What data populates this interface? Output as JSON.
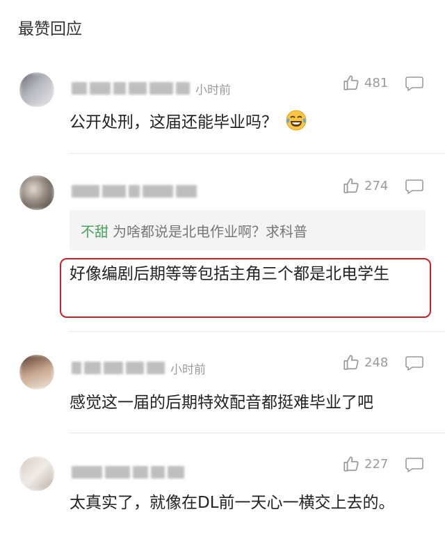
{
  "header": {
    "title": "最赞回应"
  },
  "comments": [
    {
      "time": "小时前",
      "likes": "481",
      "text": "公开处刑，这届还能毕业吗？"
    },
    {
      "time": "",
      "likes": "274",
      "quote": {
        "name": "不甜",
        "text": "为啥都说是北电作业啊？求科普"
      },
      "text": "好像编剧后期等等包括主角三个都是北电学生",
      "highlight_color": "#cc1d24"
    },
    {
      "time": "小时前",
      "likes": "248",
      "text": "感觉这一届的后期特效配音都挺难毕业了吧"
    },
    {
      "time": "",
      "likes": "227",
      "text": "太真实了，就像在DL前一天心一横交上去的。"
    }
  ],
  "icons": {
    "like": "thumbs-up-icon",
    "reply": "speech-bubble-icon",
    "emoji": "laughing-tears-emoji"
  },
  "colors": {
    "accent_green": "#4aa25a",
    "muted": "#9a9a9a",
    "highlight": "#cc1d24"
  }
}
